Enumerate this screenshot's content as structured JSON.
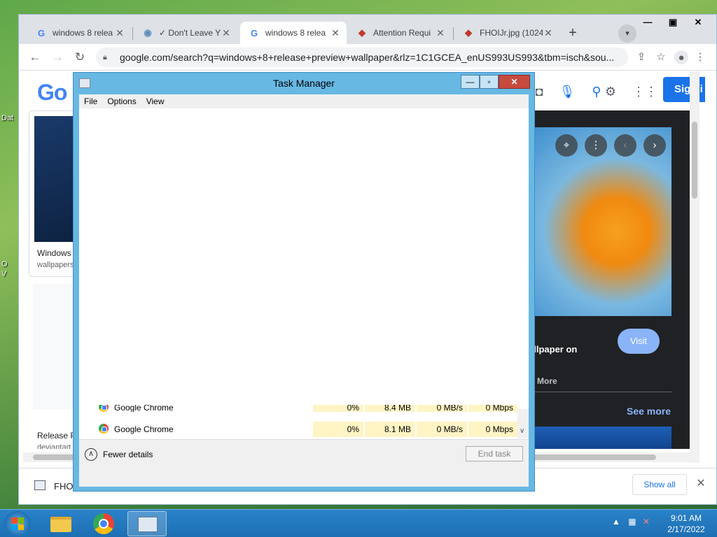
{
  "browser": {
    "tabs": [
      {
        "title": "windows 8 relea",
        "favicon": "google-icon",
        "active": false
      },
      {
        "title": "✓ Don't Leave Y",
        "favicon": "globe-icon",
        "active": false
      },
      {
        "title": "windows 8 relea",
        "favicon": "google-icon",
        "active": true
      },
      {
        "title": "Attention Requi",
        "favicon": "site-icon",
        "active": false
      },
      {
        "title": "FHOIJr.jpg (1024",
        "favicon": "site-icon",
        "active": false
      }
    ],
    "url": "google.com/search?q=windows+8+release+preview+wallpaper&rlz=1C1GCEA_enUS993US993&tbm=isch&sou..."
  },
  "google_page": {
    "logo": "Go",
    "signin_label": "Sign i",
    "result1_title": "Windows",
    "result1_source": "wallpapers",
    "result2_title": "Release P",
    "result2_source": "deviantart",
    "preview_title": "allpaper on",
    "preview_more": "More",
    "visit_label": "Visit",
    "see_more": "See more"
  },
  "download_bar": {
    "file_name": "FHOI",
    "show_all": "Show all"
  },
  "task_manager": {
    "title": "Task Manager",
    "menu": [
      "File",
      "Options",
      "View"
    ],
    "rows": [
      {
        "name": "Google Chrome",
        "cpu": "0%",
        "memory": "8.4 MB",
        "disk": "0 MB/s",
        "network": "0 Mbps"
      },
      {
        "name": "Google Chrome",
        "cpu": "0%",
        "memory": "8.1 MB",
        "disk": "0 MB/s",
        "network": "0 Mbps"
      }
    ],
    "fewer_details": "Fewer details",
    "end_task": "End task"
  },
  "taskbar": {
    "time": "9:01 AM",
    "date": "2/17/2022"
  },
  "desktop": {
    "labels": [
      "Dat",
      "O",
      "V"
    ]
  }
}
